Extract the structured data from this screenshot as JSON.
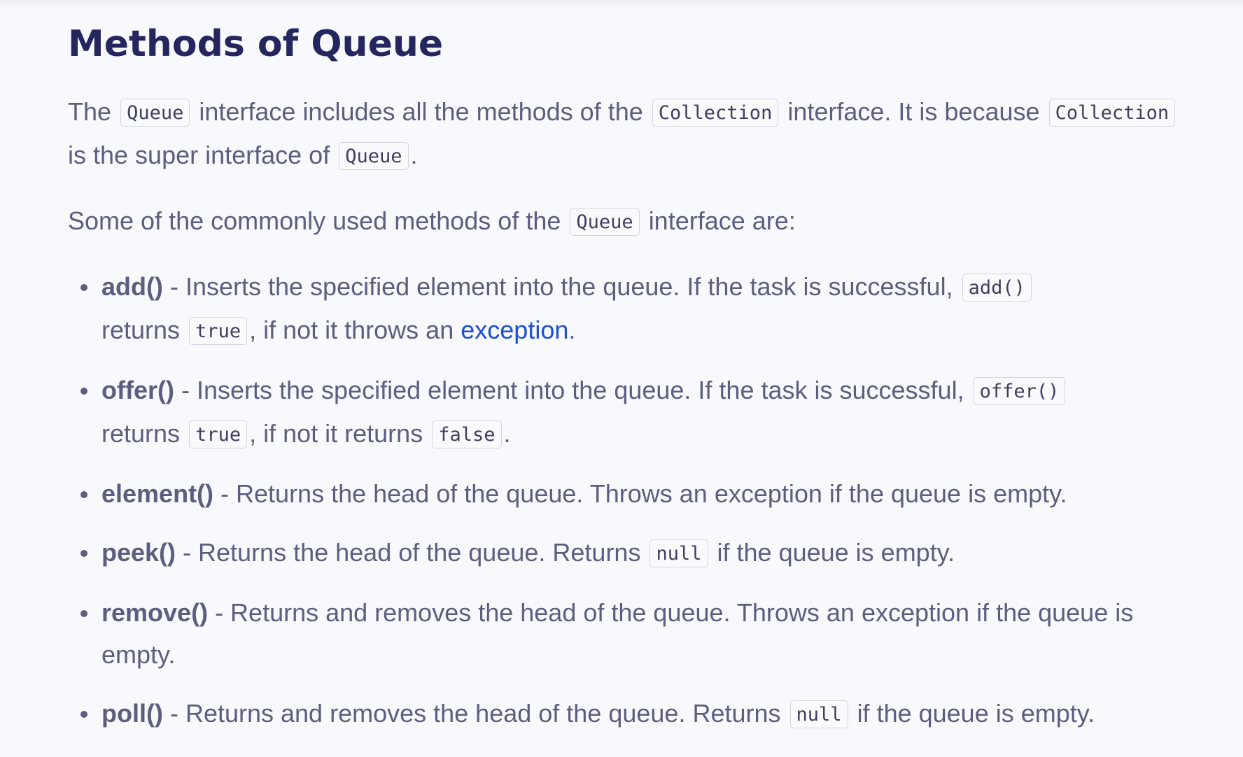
{
  "title": "Methods of Queue",
  "intro": {
    "t1": "The",
    "c1": "Queue",
    "t2": "interface includes all the methods of the",
    "c2": "Collection",
    "t3": "interface. It is because",
    "c3": "Collection",
    "t4": "is the super interface of",
    "c4": "Queue",
    "t5": "."
  },
  "lead": {
    "t1": "Some of the commonly used methods of the",
    "c1": "Queue",
    "t2": "interface are:"
  },
  "methods": {
    "add": {
      "name": "add()",
      "t1": " - Inserts the specified element into the queue. If the task is successful,",
      "c1": "add()",
      "t2": "returns",
      "c2": "true",
      "t3": ", if not it throws an",
      "link": "exception",
      "t4": "."
    },
    "offer": {
      "name": "offer()",
      "t1": " - Inserts the specified element into the queue. If the task is successful,",
      "c1": "offer()",
      "t2": "returns",
      "c2": "true",
      "t3": ", if not it returns",
      "c3": "false",
      "t4": "."
    },
    "element": {
      "name": "element()",
      "t1": " - Returns the head of the queue. Throws an exception if the queue is empty."
    },
    "peek": {
      "name": "peek()",
      "t1": " - Returns the head of the queue. Returns",
      "c1": "null",
      "t2": "if the queue is empty."
    },
    "remove": {
      "name": "remove()",
      "t1": " - Returns and removes the head of the queue. Throws an exception if the queue is empty."
    },
    "poll": {
      "name": "poll()",
      "t1": " - Returns and removes the head of the queue. Returns",
      "c1": "null",
      "t2": "if the queue is empty."
    }
  },
  "colors": {
    "heading": "#25265e",
    "body_text": "#5c5e7e",
    "link": "#1d4ed8",
    "background": "#f8f9fc",
    "code_border": "#d3d5dd"
  }
}
